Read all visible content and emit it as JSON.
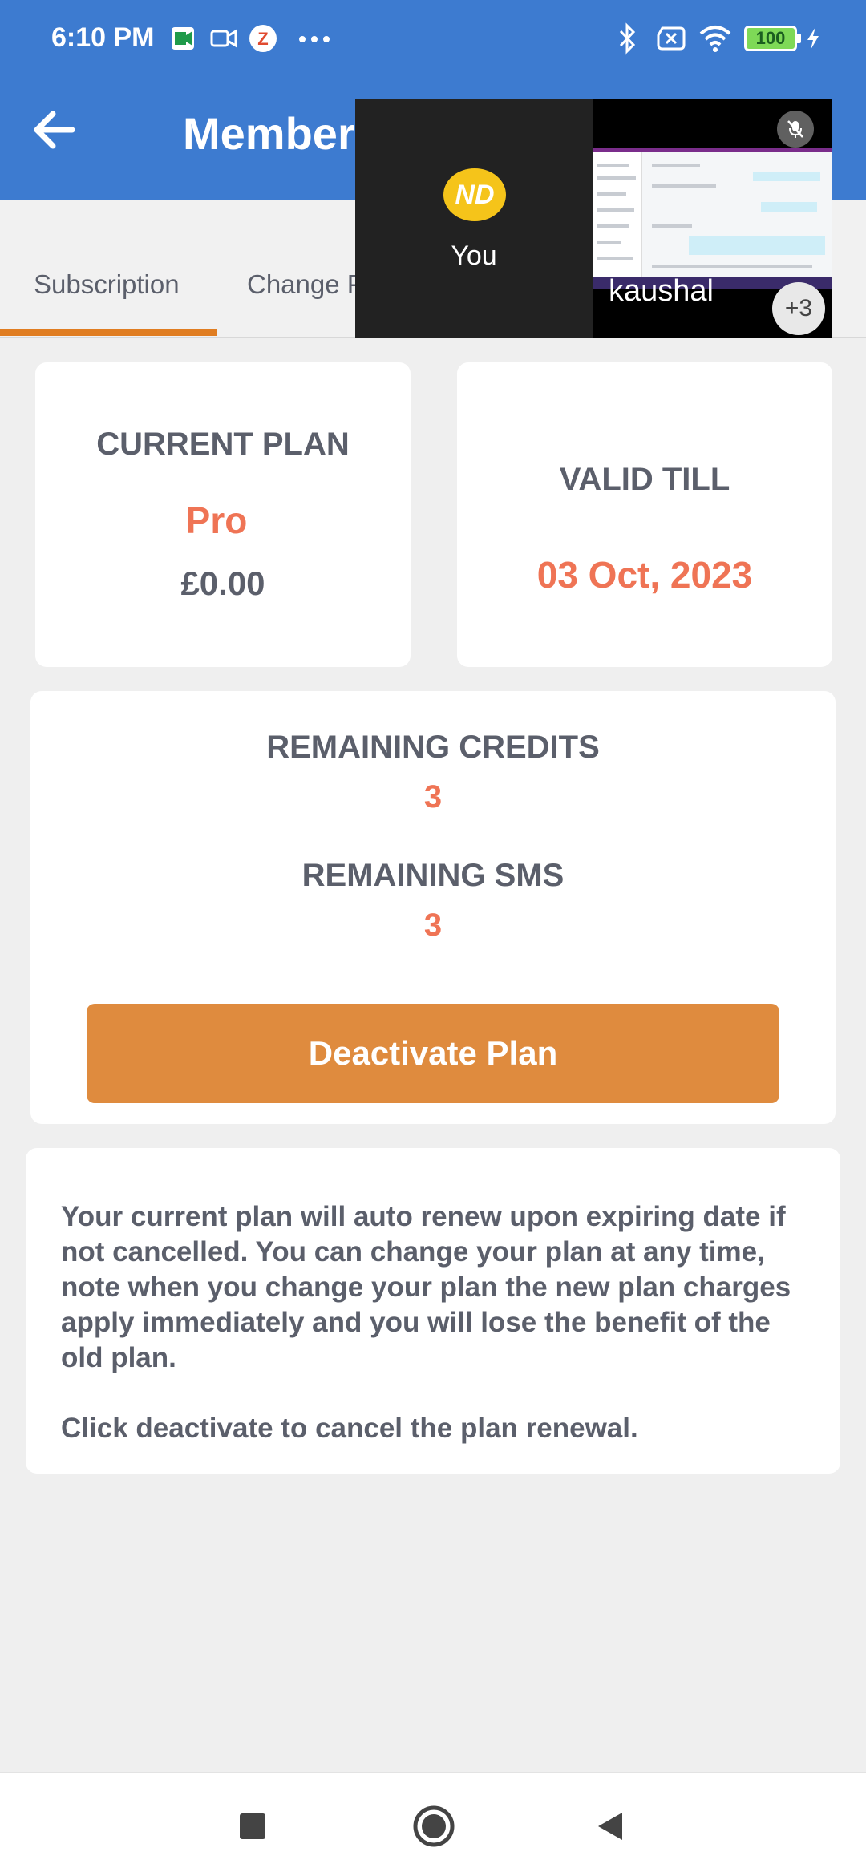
{
  "status_bar": {
    "time": "6:10 PM",
    "battery": "100",
    "icons": [
      "meet-icon",
      "video-icon",
      "zoho-icon",
      "more-dots-icon",
      "bluetooth-icon",
      "no-sim-icon",
      "wifi-icon",
      "battery-icon",
      "charging-icon"
    ]
  },
  "app_bar": {
    "title": "Members",
    "back_icon": "arrow-left-icon"
  },
  "tabs": [
    {
      "label": "Subscription",
      "active": true
    },
    {
      "label": "Change P",
      "active": false
    }
  ],
  "video_call": {
    "self_label": "You",
    "self_avatar_initials": "ND",
    "remote_name": "kaushal",
    "extra_participants": "+3"
  },
  "current_plan": {
    "label": "CURRENT PLAN",
    "plan_name": "Pro",
    "price": "£0.00"
  },
  "valid_till": {
    "label": "VALID TILL",
    "date": "03 Oct, 2023"
  },
  "credits": {
    "remaining_credits_label": "REMAINING CREDITS",
    "remaining_credits_value": "3",
    "remaining_sms_label": "REMAINING SMS",
    "remaining_sms_value": "3",
    "deactivate_button": "Deactivate Plan"
  },
  "info": {
    "paragraph1": "Your current plan will auto renew upon expiring date if not cancelled. You can change your plan at any time, note when you change your plan the new plan charges apply immediately and you will lose the benefit of the old plan.",
    "paragraph2": "Click deactivate to cancel the plan renewal."
  },
  "colors": {
    "app_bar": "#3d7bd0",
    "accent_orange": "#e07d21",
    "accent_red": "#ef7455",
    "button": "#df8b3e"
  }
}
